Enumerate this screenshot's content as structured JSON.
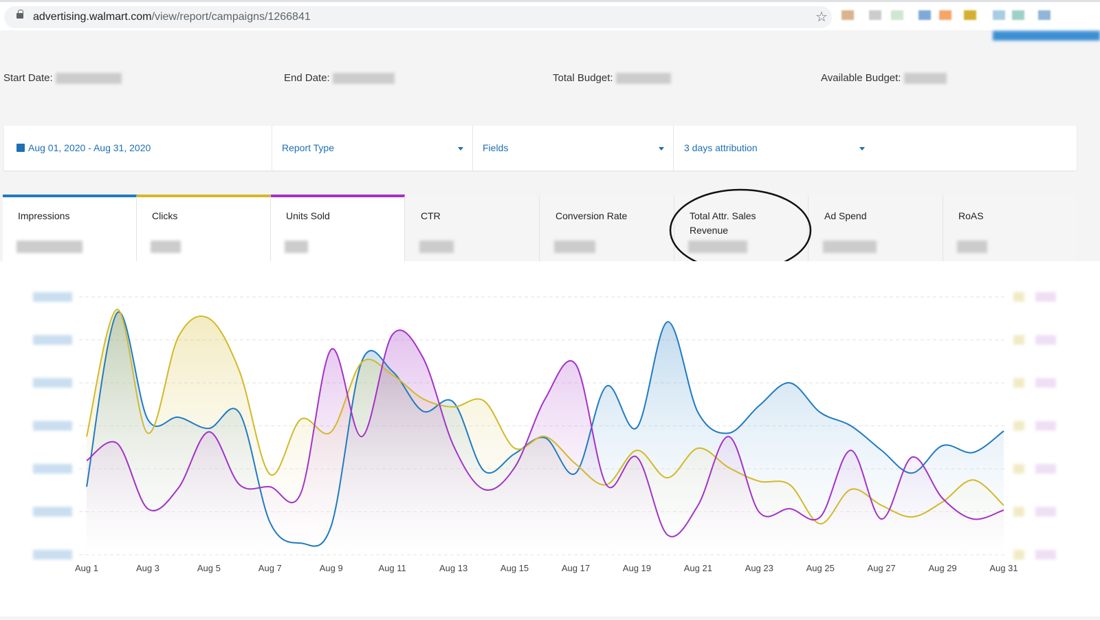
{
  "browser": {
    "url_domain": "advertising.walmart.com",
    "url_path": "/view/report/campaigns/1266841"
  },
  "header": {
    "start_date_label": "Start Date:",
    "end_date_label": "End Date:",
    "total_budget_label": "Total Budget:",
    "available_budget_label": "Available Budget:"
  },
  "filters": {
    "date_range": "Aug 01, 2020 - Aug 31, 2020",
    "report_type": "Report Type",
    "fields": "Fields",
    "attribution": "3 days attribution"
  },
  "metrics": [
    {
      "label": "Impressions",
      "color": "#1f7bc1",
      "active": true
    },
    {
      "label": "Clicks",
      "color": "#d2b929",
      "active": true
    },
    {
      "label": "Units Sold",
      "color": "#a332c6",
      "active": true
    },
    {
      "label": "CTR"
    },
    {
      "label": "Conversion Rate"
    },
    {
      "label": "Total Attr. Sales Revenue",
      "highlighted": true
    },
    {
      "label": "Ad Spend"
    },
    {
      "label": "RoAS"
    }
  ],
  "chart_data": {
    "type": "area",
    "x": [
      "Aug 1",
      "Aug 2",
      "Aug 3",
      "Aug 4",
      "Aug 5",
      "Aug 6",
      "Aug 7",
      "Aug 8",
      "Aug 9",
      "Aug 10",
      "Aug 11",
      "Aug 12",
      "Aug 13",
      "Aug 14",
      "Aug 15",
      "Aug 16",
      "Aug 17",
      "Aug 18",
      "Aug 19",
      "Aug 20",
      "Aug 21",
      "Aug 22",
      "Aug 23",
      "Aug 24",
      "Aug 25",
      "Aug 26",
      "Aug 27",
      "Aug 28",
      "Aug 29",
      "Aug 30",
      "Aug 31"
    ],
    "x_tick_labels": [
      "Aug 1",
      "Aug 3",
      "Aug 5",
      "Aug 7",
      "Aug 9",
      "Aug 11",
      "Aug 13",
      "Aug 15",
      "Aug 17",
      "Aug 19",
      "Aug 21",
      "Aug 23",
      "Aug 25",
      "Aug 27",
      "Aug 29",
      "Aug 31"
    ],
    "y_ticks_obscured": true,
    "ylim": [
      0,
      6
    ],
    "grid": true,
    "smooth": true,
    "series": [
      {
        "name": "Impressions",
        "color": "#1f7bc1",
        "values": [
          1.58,
          5.63,
          3.15,
          3.2,
          2.94,
          3.3,
          0.75,
          0.27,
          0.67,
          4.5,
          4.27,
          3.34,
          3.55,
          1.95,
          2.35,
          2.72,
          1.9,
          3.92,
          2.96,
          5.42,
          3.31,
          2.83,
          3.47,
          4.0,
          3.31,
          3.0,
          2.43,
          1.9,
          2.54,
          2.38,
          2.88
        ]
      },
      {
        "name": "Clicks",
        "color": "#d2b929",
        "values": [
          2.75,
          5.71,
          2.83,
          5.07,
          5.5,
          4.27,
          1.87,
          3.15,
          2.86,
          4.48,
          4.19,
          3.63,
          3.44,
          3.58,
          2.48,
          2.75,
          2.11,
          1.63,
          2.43,
          1.79,
          2.48,
          2.03,
          1.71,
          1.63,
          0.72,
          1.52,
          1.15,
          0.88,
          1.23,
          1.74,
          1.15
        ]
      },
      {
        "name": "Units Sold",
        "color": "#a332c6",
        "values": [
          2.19,
          2.59,
          1.07,
          1.55,
          2.86,
          1.63,
          1.58,
          1.42,
          4.78,
          2.75,
          5.12,
          4.59,
          2.54,
          1.52,
          2.03,
          3.63,
          4.43,
          1.63,
          2.27,
          0.46,
          1.15,
          2.75,
          0.99,
          1.07,
          0.88,
          2.43,
          0.83,
          2.27,
          1.31,
          0.83,
          1.04
        ]
      }
    ]
  }
}
